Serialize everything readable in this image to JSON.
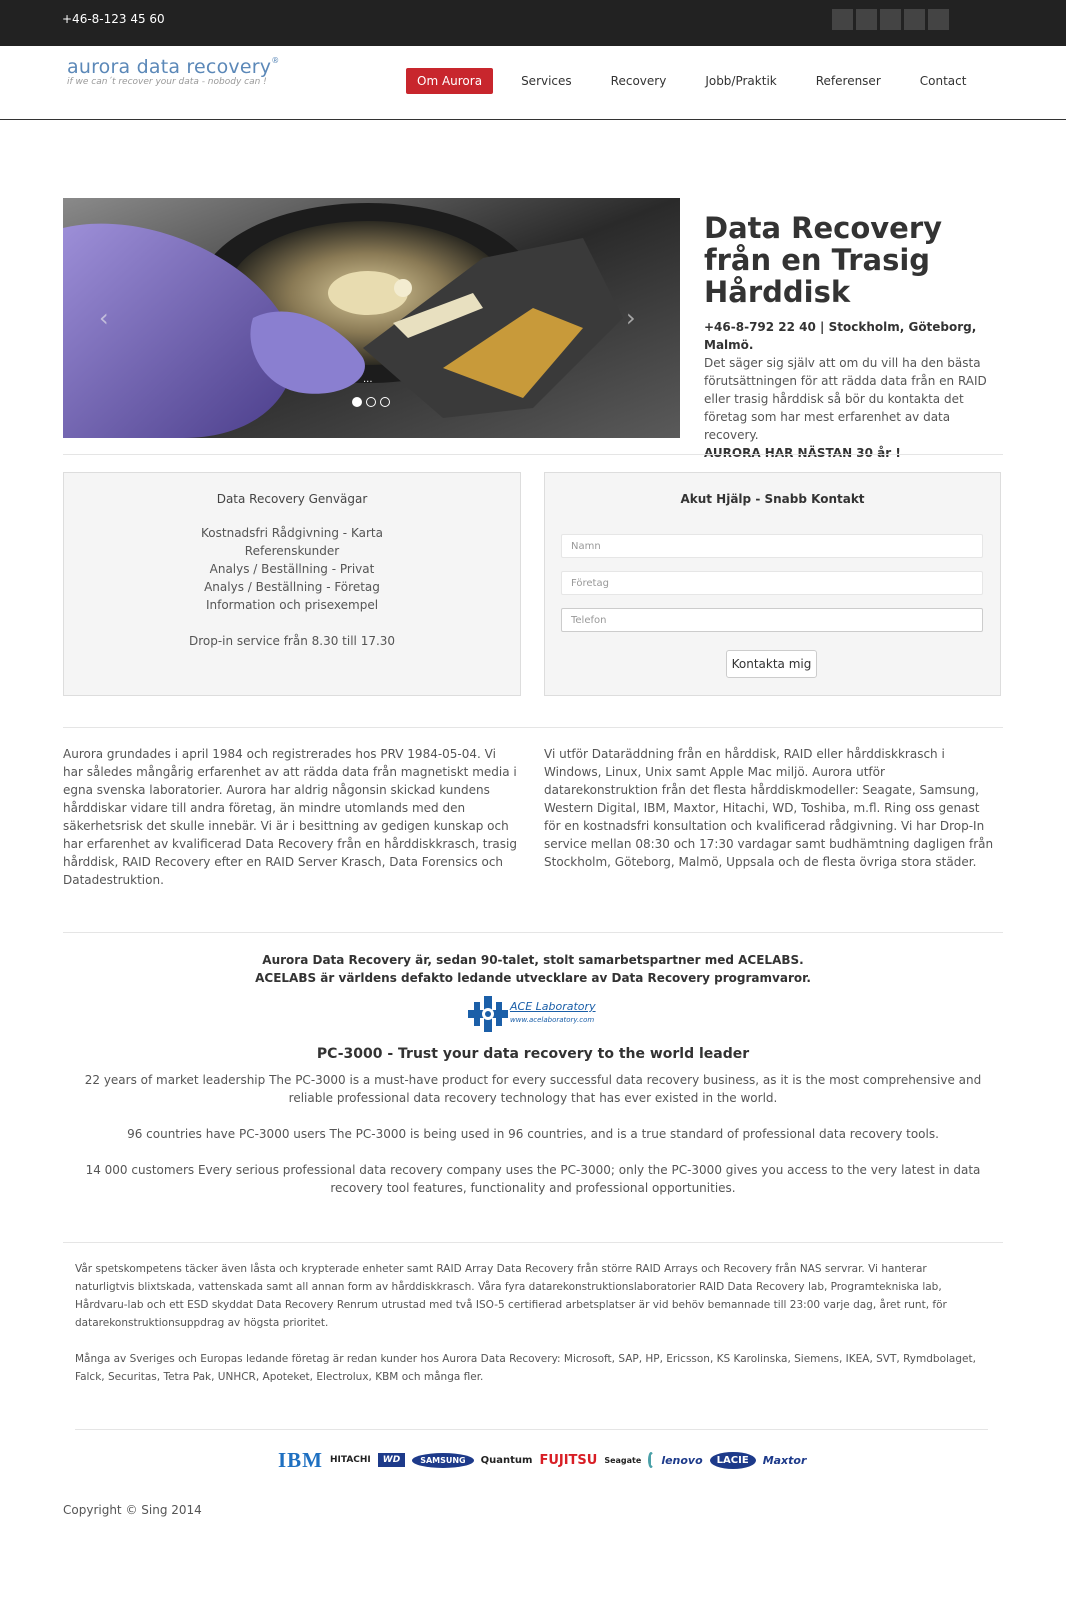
{
  "topbar": {
    "phone": "+46-8-123 45 60"
  },
  "logo": {
    "name": "aurora data recovery",
    "tagline": "if we can´t recover your data - nobody can !"
  },
  "nav": {
    "items": [
      {
        "label": "Om Aurora",
        "active": true
      },
      {
        "label": "Services"
      },
      {
        "label": "Recovery"
      },
      {
        "label": "Jobb/Praktik"
      },
      {
        "label": "Referenser"
      },
      {
        "label": "Contact"
      }
    ]
  },
  "hero": {
    "title": "Data Recovery från en Trasig Hårddisk",
    "contact_line": "+46-8-792 22 40 | Stockholm, Göteborg, Malmö.",
    "body": "Det säger sig själv att om du vill ha den bästa förutsättningen för att rädda data från en RAID eller trasig hårddisk så bör du kontakta det företag som har mest erfarenhet av data recovery.",
    "highlight": "AURORA HAR NÄSTAN 30 år !",
    "caption": "..."
  },
  "shortcuts": {
    "title": "Data Recovery Genvägar",
    "links": [
      "Kostnadsfri Rådgivning - Karta",
      "Referenskunder",
      "Analys / Beställning - Privat",
      "Analys / Beställning - Företag",
      "Information och prisexempel"
    ],
    "dropin": "Drop-in service från 8.30 till 17.30"
  },
  "contact_form": {
    "title": "Akut Hjälp - Snabb Kontakt",
    "name_placeholder": "Namn",
    "company_placeholder": "Företag",
    "phone_placeholder": "Telefon",
    "submit": "Kontakta mig"
  },
  "about": {
    "left": "Aurora grundades i april 1984 och registrerades hos PRV 1984-05-04. Vi har således mångårig erfarenhet av att rädda data från magnetiskt media i egna svenska laboratorier. Aurora har aldrig någonsin skickad kundens hårddiskar vidare till andra företag, än mindre utomlands med den säkerhetsrisk det skulle innebär. Vi är i besittning av gedigen kunskap och har erfarenhet av kvalificerad Data Recovery från en hårddiskkrasch, trasig hårddisk, RAID Recovery efter en RAID Server Krasch, Data Forensics och Datadestruktion.",
    "right": "Vi utför Dataräddning från en hårddisk, RAID eller hårddiskkrasch i Windows, Linux, Unix samt Apple Mac miljö. Aurora utför datarekonstruktion från det flesta hårddiskmodeller: Seagate, Samsung, Western Digital, IBM, Maxtor, Hitachi, WD, Toshiba, m.fl. Ring oss genast för en kostnadsfri konsultation och kvalificerad rådgivning. Vi har Drop-In service mellan 08:30 och 17:30 vardagar samt budhämtning dagligen från Stockholm, Göteborg, Malmö, Uppsala och de flesta övriga stora städer."
  },
  "partner": {
    "line1": "Aurora Data Recovery är, sedan 90-talet, stolt samarbetspartner med ACELABS.",
    "line2": "ACELABS är världens defakto ledande utvecklare av Data Recovery programvaror.",
    "ace_name": "ACE Laboratory",
    "ace_url": "www.acelaboratory.com",
    "heading": "PC-3000 - Trust your data recovery to the world leader",
    "p1": "22 years of market leadership The PC-3000 is a must-have product for every successful data recovery business, as it is the most comprehensive and reliable professional data recovery technology that has ever existed in the world.",
    "p2": "96 countries have PC-3000 users The PC-3000 is being used in 96 countries, and is a true standard of professional data recovery tools.",
    "p3": "14 000 customers Every serious professional data recovery company uses the PC-3000; only the PC-3000 gives you access to the very latest in data recovery tool features, functionality and professional opportunities."
  },
  "footer_text": {
    "p1": "Vår spetskompetens täcker även låsta och krypterade enheter samt RAID Array Data Recovery från större RAID Arrays och Recovery från NAS servrar. Vi hanterar naturligtvis blixtskada, vattenskada samt all annan form av hårddiskkrasch. Våra fyra datarekonstruktionslaboratorier RAID Data Recovery lab, Programtekniska lab, Hårdvaru-lab och ett ESD skyddat Data Recovery Renrum utrustad med två ISO-5 certifierad arbetsplatser är vid behöv bemannade till 23:00 varje dag, året runt, för datarekonstruktionsuppdrag av högsta prioritet.",
    "p2": "Många av Sveriges och Europas ledande företag är redan kunder hos Aurora Data Recovery: Microsoft, SAP, HP, Ericsson, KS Karolinska, Siemens, IKEA, SVT, Rymdbolaget, Falck, Securitas, Tetra Pak, UNHCR, Apoteket, Electrolux, KBM och många fler."
  },
  "brands": [
    "IBM",
    "HITACHI",
    "WD",
    "SAMSUNG",
    "Quantum",
    "FUJITSU",
    "Seagate",
    "lenovo",
    "LACIE",
    "Maxtor"
  ],
  "copyright": "Copyright © Sing 2014"
}
